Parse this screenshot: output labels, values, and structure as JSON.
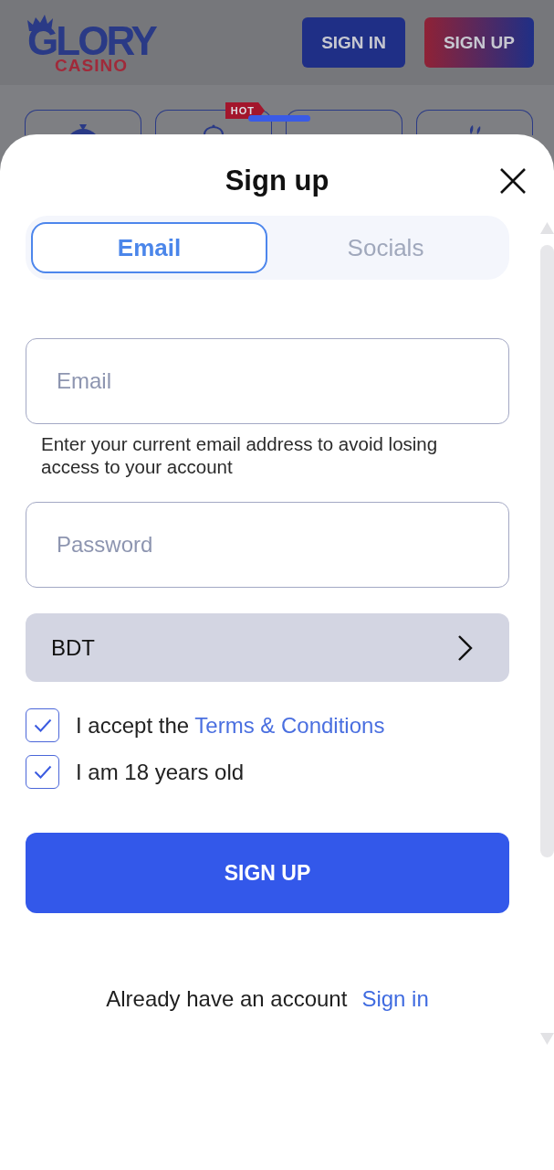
{
  "header": {
    "logo": {
      "title": "GLORY",
      "subtitle": "CASINO"
    },
    "buttons": [
      {
        "label": "SIGN IN",
        "kind": "solid"
      },
      {
        "label": "SIGN UP",
        "kind": "gradient"
      }
    ]
  },
  "categories": [
    {
      "kind": "wheel"
    },
    {
      "kind": "dome",
      "badge": "HOT"
    },
    {
      "kind": "blank"
    },
    {
      "kind": "sprout"
    }
  ],
  "dialog": {
    "title": "Sign up",
    "tabs": [
      {
        "label": "Email",
        "selected": true
      },
      {
        "label": "Socials",
        "selected": false
      }
    ],
    "fields": [
      {
        "placeholder": "Email",
        "hint": "Enter your current email address to avoid losing access to your account"
      },
      {
        "placeholder": "Password"
      }
    ],
    "currency": {
      "value": "BDT"
    },
    "checkboxes": [
      {
        "text": "I accept the",
        "link": "Terms & Conditions",
        "checked": true
      },
      {
        "text": "I am 18 years old",
        "checked": true
      }
    ],
    "submit": {
      "label": "SIGN UP"
    },
    "footer": {
      "text": "Already have an account",
      "link": "Sign in"
    }
  }
}
